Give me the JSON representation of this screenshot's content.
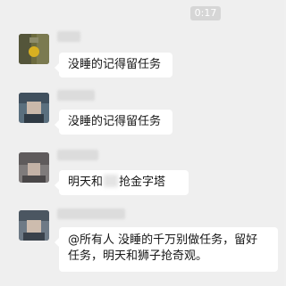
{
  "time_badge": "0:17",
  "messages": [
    {
      "sender": "",
      "text": "没睡的记得留任务"
    },
    {
      "sender": "",
      "text": "没睡的记得留任务"
    },
    {
      "sender": "",
      "text_before": "明天和",
      "text_after": "抢金字塔"
    },
    {
      "sender": "",
      "line1": "@所有人 没睡的千万别做任务，留好",
      "line2": "任务，明天和狮子抢奇观。"
    }
  ]
}
